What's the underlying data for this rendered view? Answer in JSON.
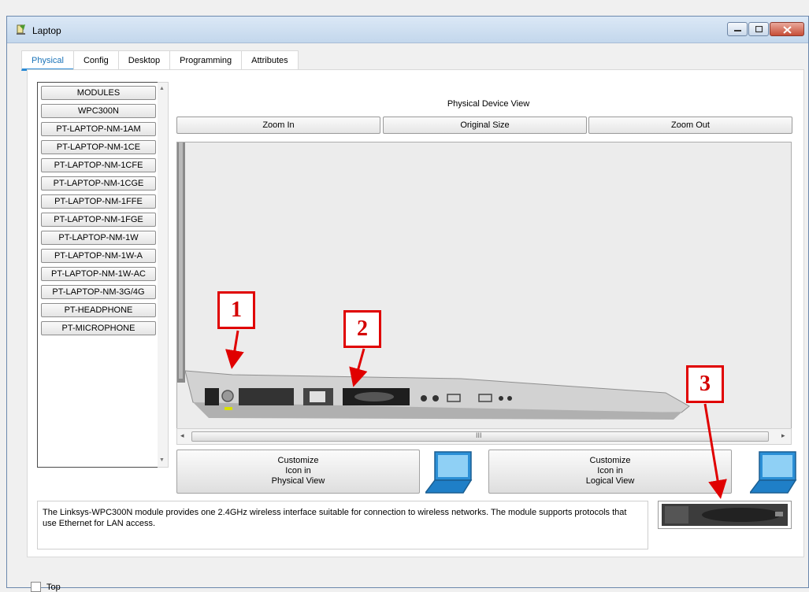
{
  "window": {
    "title": "Laptop"
  },
  "tabs": [
    "Physical",
    "Config",
    "Desktop",
    "Programming",
    "Attributes"
  ],
  "modules": {
    "items": [
      "MODULES",
      "WPC300N",
      "PT-LAPTOP-NM-1AM",
      "PT-LAPTOP-NM-1CE",
      "PT-LAPTOP-NM-1CFE",
      "PT-LAPTOP-NM-1CGE",
      "PT-LAPTOP-NM-1FFE",
      "PT-LAPTOP-NM-1FGE",
      "PT-LAPTOP-NM-1W",
      "PT-LAPTOP-NM-1W-A",
      "PT-LAPTOP-NM-1W-AC",
      "PT-LAPTOP-NM-3G/4G",
      "PT-HEADPHONE",
      "PT-MICROPHONE"
    ]
  },
  "physical_view": {
    "title": "Physical Device View",
    "zoom_in": "Zoom In",
    "original_size": "Original Size",
    "zoom_out": "Zoom Out",
    "scroll_grip": "III"
  },
  "customize": {
    "physical": [
      "Customize",
      "Icon in",
      "Physical View"
    ],
    "logical": [
      "Customize",
      "Icon in",
      "Logical View"
    ]
  },
  "description": "The Linksys-WPC300N module provides one 2.4GHz wireless interface suitable for connection to wireless networks. The module supports protocols that use Ethernet for LAN access.",
  "callouts": [
    "1",
    "2",
    "3"
  ],
  "footer": {
    "top_label": "Top"
  },
  "colors": {
    "callout": "#e00000",
    "active_tab": "#1a73b8",
    "laptop_icon": "#2b8fd6"
  }
}
